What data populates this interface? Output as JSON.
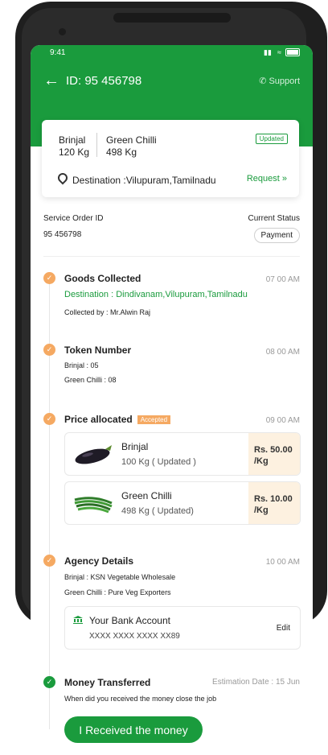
{
  "status_bar": {
    "time": "9:41"
  },
  "nav": {
    "title": "ID: 95 456798",
    "support": "Support"
  },
  "summary": {
    "crops": [
      {
        "name": "Brinjal",
        "qty": "120 Kg"
      },
      {
        "name": "Green Chilli",
        "qty": "498 Kg"
      }
    ],
    "badge": "Updated",
    "destination": "Destination :Vilupuram,Tamilnadu",
    "request": "Request »"
  },
  "service": {
    "id_label": "Service Order ID",
    "id_value": "95 456798",
    "status_label": "Current Status",
    "status_value": "Payment"
  },
  "timeline": {
    "goods": {
      "title": "Goods Collected",
      "time": "07 00 AM",
      "destination": "Destination : Dindivanam,Vilupuram,Tamilnadu",
      "collected_by": "Collected by : Mr.Alwin Raj"
    },
    "token": {
      "title": "Token Number",
      "time": "08 00 AM",
      "lines": [
        "Brinjal : 05",
        "Green Chilli : 08"
      ]
    },
    "price": {
      "title": "Price allocated",
      "badge": "Accepted",
      "time": "09 00 AM",
      "items": [
        {
          "name": "Brinjal",
          "qty": "100 Kg ( Updated )",
          "rate": "Rs. 50.00",
          "unit": "/Kg"
        },
        {
          "name": "Green Chilli",
          "qty": "498 Kg ( Updated)",
          "rate": "Rs. 10.00",
          "unit": "/Kg"
        }
      ]
    },
    "agency": {
      "title": "Agency Details",
      "time": "10 00 AM",
      "lines": [
        "Brinjal : KSN Vegetable Wholesale",
        "Green Chilli : Pure Veg Exporters"
      ],
      "bank_title": "Your Bank Account",
      "bank_number": "XXXX XXXX XXXX XX89",
      "edit": "Edit"
    },
    "money": {
      "title": "Money Transferred",
      "estimation": "Estimation Date : 15 Jun",
      "description": "When did you received the money close the job",
      "button": "I Received the money"
    }
  },
  "colors": {
    "primary": "#1a9b3d",
    "accent": "#f5a962",
    "rate_bg": "#fdf1e0"
  },
  "icons": [
    "back-arrow-icon",
    "phone-icon",
    "location-pin-icon",
    "check-icon",
    "eggplant-icon",
    "green-chilli-icon",
    "bank-icon",
    "signal-icon",
    "wifi-icon",
    "battery-icon"
  ]
}
